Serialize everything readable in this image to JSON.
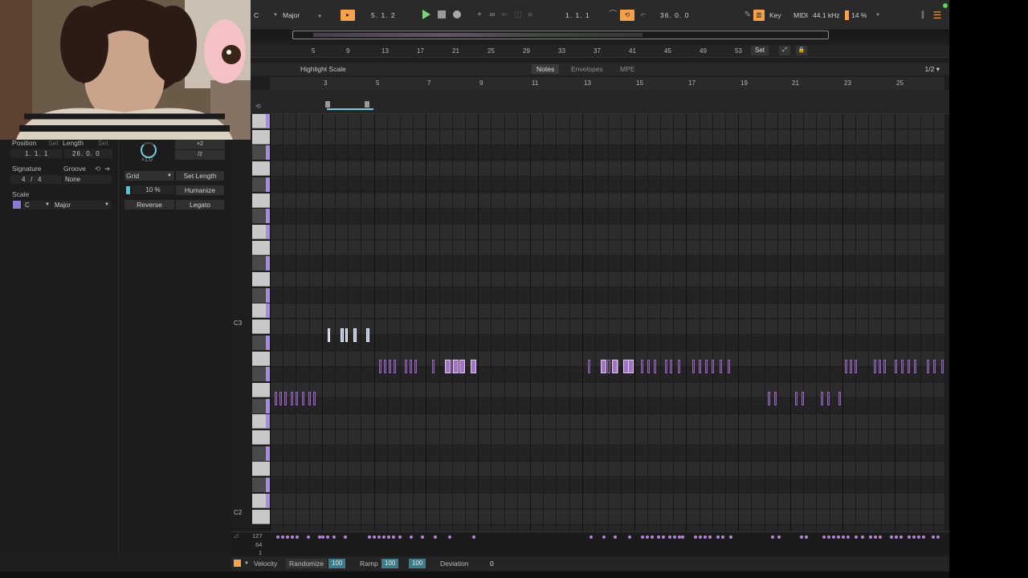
{
  "transport": {
    "key_root": "C",
    "scale_name": "Major",
    "arrangement_position": "5.  1.  2",
    "loop_start": "1.  1.  1",
    "loop_length": "36.  0.  0",
    "key_button": "Key",
    "midi_label": "MIDI",
    "sample_rate": "44.1 kHz",
    "cpu_load": "14 %"
  },
  "arrangement_ruler": {
    "ticks": [
      "5",
      "9",
      "13",
      "17",
      "21",
      "25",
      "29",
      "33",
      "37",
      "41",
      "45",
      "49",
      "53"
    ],
    "set_button": "Set"
  },
  "clip_header": {
    "highlight_scale": "Highlight Scale",
    "tabs": [
      "Notes",
      "Envelopes",
      "MPE"
    ],
    "active_tab": "Notes",
    "grid_zoom": "1/2"
  },
  "clip_ruler": {
    "ticks": [
      "3",
      "5",
      "7",
      "9",
      "11",
      "13",
      "15",
      "17",
      "19",
      "21",
      "23",
      "25"
    ]
  },
  "left_panel": {
    "position_label": "Position",
    "position_set": "Set",
    "length_label": "Length",
    "length_set": "Set",
    "position_value": [
      "1.",
      "1.",
      "1"
    ],
    "length_value": [
      "26.",
      "0.",
      "0"
    ],
    "signature_label": "Signature",
    "signature_num": "4",
    "signature_den": "4",
    "groove_label": "Groove",
    "groove_value": "None",
    "scale_label": "Scale",
    "scale_root": "C",
    "scale_name": "Major",
    "knob_value": "×1.0",
    "mult_x2": "×2",
    "div_2": "/2",
    "grid_label": "Grid",
    "set_length": "Set Length",
    "humanize_amount": "10 %",
    "humanize": "Humanize",
    "reverse": "Reverse",
    "legato": "Legato"
  },
  "keyboard": {
    "c3_label": "C3",
    "c2_label": "C2"
  },
  "velocity_lane": {
    "max": "127",
    "mid": "64",
    "min": "1"
  },
  "bottom_toolbar": {
    "velocity_label": "Velocity",
    "randomize_label": "Randomize",
    "randomize_value": "100",
    "ramp_label": "Ramp",
    "ramp_start": "100",
    "ramp_end": "100",
    "deviation_label": "Deviation",
    "deviation_value": "0"
  },
  "colors": {
    "note": "#a371c7",
    "accent_orange": "#f6a24a",
    "accent_cyan": "#4cc7d8",
    "scale_highlight": "#a98be6"
  }
}
